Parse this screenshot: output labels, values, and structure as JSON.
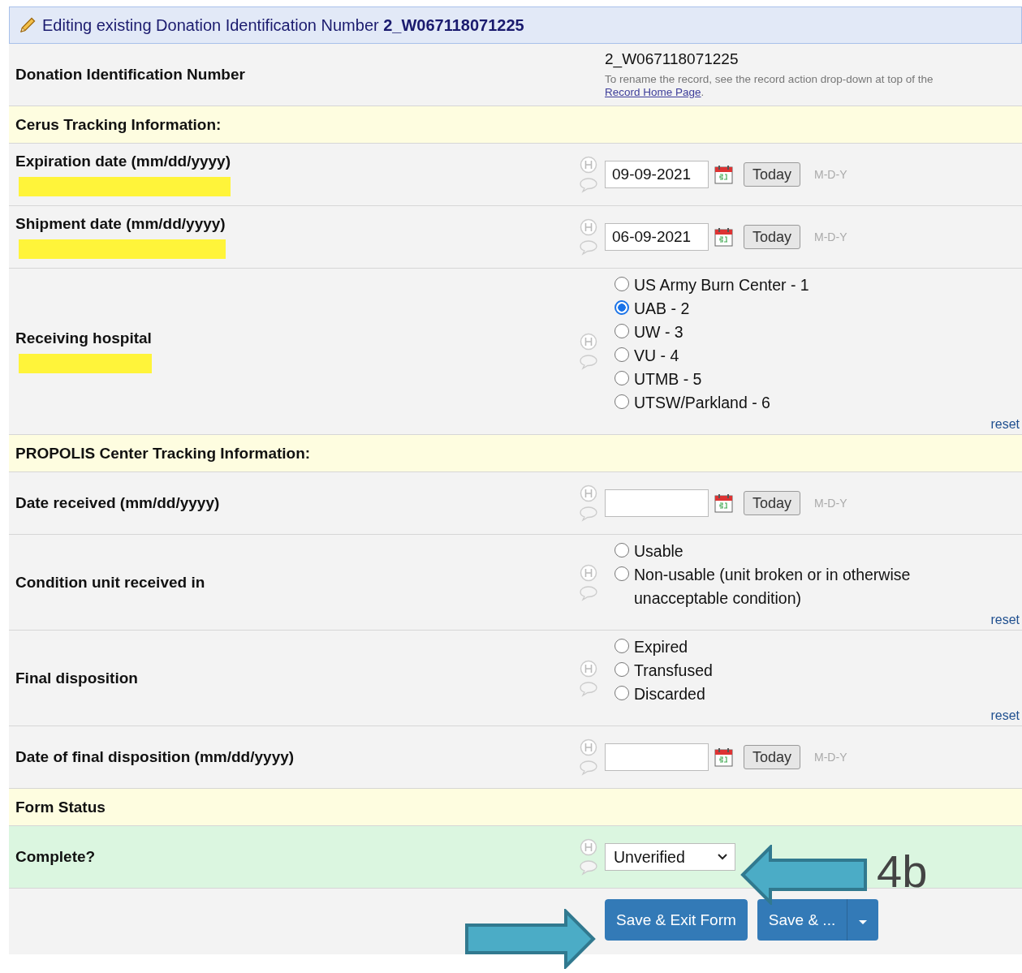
{
  "header": {
    "text": "Editing existing Donation Identification Number **2_W067118071225**"
  },
  "rows": [
    {
      "kind": "id",
      "label": "Donation Identification Number",
      "value": "2_W067118071225",
      "note": "To rename the record, see the record action drop-down at top of the",
      "link": "Record Home Page",
      "note_end": "."
    },
    {
      "kind": "section",
      "label": "Cerus Tracking Information:"
    },
    {
      "kind": "date",
      "label": "Expiration date (mm/dd/yyyy)",
      "highlighted": true,
      "value": "09-09-2021",
      "button": "Today",
      "format": "M-D-Y"
    },
    {
      "kind": "date",
      "label": "Shipment date (mm/dd/yyyy)",
      "highlighted": true,
      "value": "06-09-2021",
      "button": "Today",
      "format": "M-D-Y"
    },
    {
      "kind": "radio",
      "label": "Receiving hospital",
      "highlighted": true,
      "options": [
        {
          "label": "US Army Burn Center - 1",
          "selected": false
        },
        {
          "label": "UAB - 2",
          "selected": true
        },
        {
          "label": "UW - 3",
          "selected": false
        },
        {
          "label": "VU - 4",
          "selected": false
        },
        {
          "label": "UTMB - 5",
          "selected": false
        },
        {
          "label": "UTSW/Parkland - 6",
          "selected": false
        }
      ],
      "reset": "reset"
    },
    {
      "kind": "section",
      "label": "PROPOLIS Center Tracking Information:"
    },
    {
      "kind": "date",
      "label": "Date received (mm/dd/yyyy)",
      "button": "Today",
      "format": "M-D-Y"
    },
    {
      "kind": "radio",
      "label": "Condition unit received in",
      "options": [
        {
          "label": "Usable",
          "selected": false
        },
        {
          "label": "Non-usable (unit broken or in otherwise unacceptable condition)",
          "selected": false
        }
      ],
      "reset": "reset"
    },
    {
      "kind": "radio",
      "label": "Final disposition",
      "options": [
        {
          "label": "Expired",
          "selected": false
        },
        {
          "label": "Transfused",
          "selected": false
        },
        {
          "label": "Discarded",
          "selected": false
        }
      ],
      "reset": "reset"
    },
    {
      "kind": "date",
      "label": "Date of final disposition (mm/dd/yyyy)",
      "button": "Today",
      "format": "M-D-Y"
    },
    {
      "kind": "section",
      "label": "Form Status"
    },
    {
      "kind": "select",
      "label": "Complete?",
      "value": "Unverified"
    }
  ],
  "buttons": [
    {
      "label": "Save & Exit Form",
      "dropdown": false
    },
    {
      "label": "Save & ...",
      "dropdown": true
    }
  ],
  "annotations": [
    {
      "kind": "arrow-left",
      "label": "4b"
    },
    {
      "kind": "arrow-right"
    }
  ]
}
